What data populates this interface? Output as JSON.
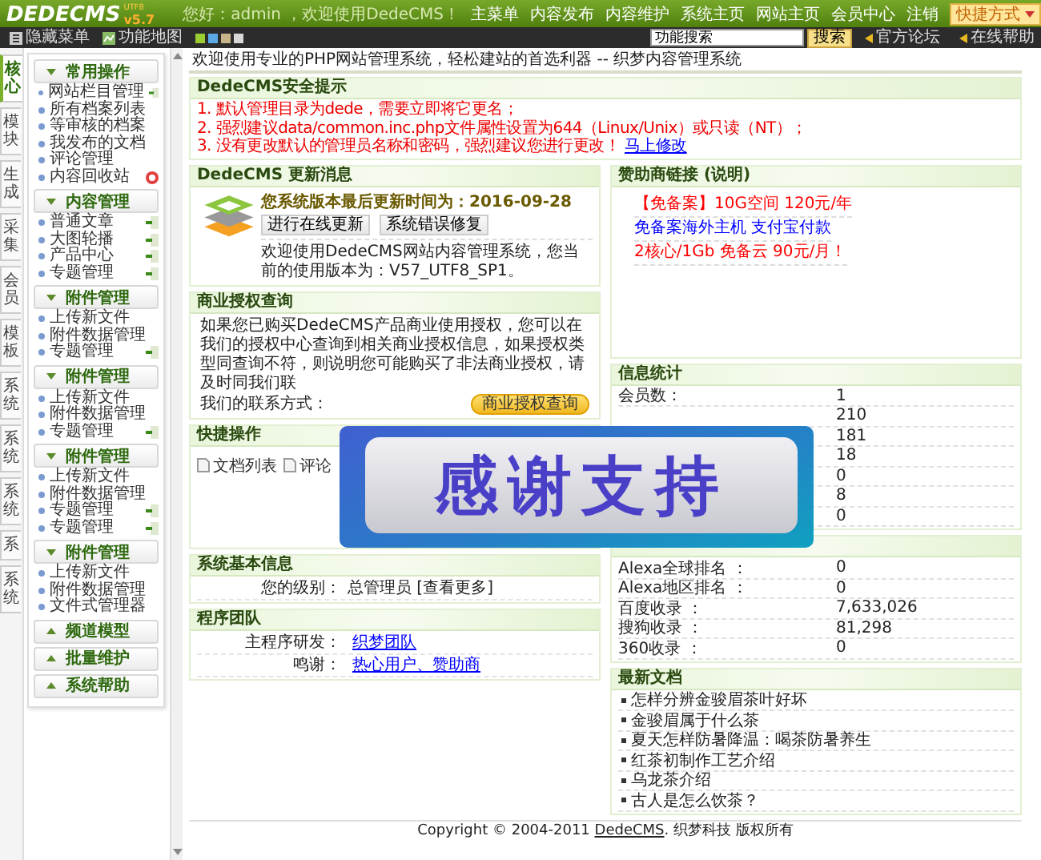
{
  "header": {
    "logo": "DEDECMS",
    "version": "v5.7",
    "edition": "UTF8",
    "greeting": "您好：admin ，欢迎使用DedeCMS！",
    "nav": [
      "主菜单",
      "内容发布",
      "内容维护",
      "系统主页",
      "网站主页",
      "会员中心",
      "注销"
    ],
    "shortcut": "快捷方式"
  },
  "toolbar": {
    "hide_menu": "隐藏菜单",
    "site_map": "功能地图",
    "themes": [
      {
        "color": "#9acd32"
      },
      {
        "color": "#5aa9e6"
      },
      {
        "color": "#c8b48a"
      },
      {
        "color": "#d8d8d8"
      }
    ],
    "search": {
      "value": "功能搜索"
    },
    "search_button": "搜索",
    "links": [
      "官方论坛",
      "在线帮助"
    ]
  },
  "side_tabs": [
    {
      "label": "核心",
      "selected": true
    },
    {
      "label": "模块",
      "selected": false
    },
    {
      "label": "生成",
      "selected": false
    },
    {
      "label": "采集",
      "selected": false
    },
    {
      "label": "会员",
      "selected": false
    },
    {
      "label": "模板",
      "selected": false
    },
    {
      "label": "系统",
      "selected": false
    },
    {
      "label": "系统",
      "selected": false
    },
    {
      "label": "系统",
      "selected": false
    },
    {
      "label": "系",
      "selected": false
    },
    {
      "label": "系统",
      "selected": false
    }
  ],
  "menu": [
    {
      "title": "常用操作",
      "expanded": true,
      "items": [
        {
          "label": "网站栏目管理",
          "kind": "add"
        },
        {
          "label": "所有档案列表",
          "kind": "plain"
        },
        {
          "label": "等审核的档案",
          "kind": "plain"
        },
        {
          "label": "我发布的文档",
          "kind": "plain"
        },
        {
          "label": "评论管理",
          "kind": "plain"
        },
        {
          "label": "内容回收站",
          "kind": "trash"
        }
      ]
    },
    {
      "title": "内容管理",
      "expanded": true,
      "items": [
        {
          "label": "普通文章",
          "kind": "add"
        },
        {
          "label": "大图轮播",
          "kind": "add"
        },
        {
          "label": "产品中心",
          "kind": "add"
        },
        {
          "label": "专题管理",
          "kind": "add"
        }
      ]
    },
    {
      "title": "附件管理",
      "expanded": true,
      "items": [
        {
          "label": "上传新文件",
          "kind": "plain"
        },
        {
          "label": "附件数据管理",
          "kind": "plain"
        },
        {
          "label": "专题管理",
          "kind": "add"
        }
      ]
    },
    {
      "title": "附件管理",
      "expanded": true,
      "items": [
        {
          "label": "上传新文件",
          "kind": "plain"
        },
        {
          "label": "附件数据管理",
          "kind": "plain"
        },
        {
          "label": "专题管理",
          "kind": "add"
        }
      ]
    },
    {
      "title": "附件管理",
      "expanded": true,
      "items": [
        {
          "label": "上传新文件",
          "kind": "plain"
        },
        {
          "label": "附件数据管理",
          "kind": "plain"
        },
        {
          "label": "专题管理",
          "kind": "add"
        },
        {
          "label": "专题管理",
          "kind": "add"
        }
      ]
    },
    {
      "title": "附件管理",
      "expanded": true,
      "items": [
        {
          "label": "上传新文件",
          "kind": "plain"
        },
        {
          "label": "附件数据管理",
          "kind": "plain"
        },
        {
          "label": "文件式管理器",
          "kind": "plain"
        }
      ]
    },
    {
      "title": "频道模型",
      "expanded": false
    },
    {
      "title": "批量维护",
      "expanded": false
    },
    {
      "title": "系统帮助",
      "expanded": false
    }
  ],
  "breadcrumb": "欢迎使用专业的PHP网站管理系统，轻松建站的首选利器 -- 织梦内容管理系统",
  "security": {
    "title": "DedeCMS安全提示",
    "tips": [
      "1. 默认管理目录为dede，需要立即将它更名；",
      "2. 强烈建议data/common.inc.php文件属性设置为644（Linux/Unix）或只读（NT）；",
      "3. 没有更改默认的管理员名称和密码，强烈建议您进行更改！"
    ],
    "link": "马上修改"
  },
  "update": {
    "title": "DedeCMS 更新消息",
    "date_line": "您系统版本最后更新时间为：2016-09-28",
    "buttons": [
      "进行在线更新",
      "系统错误修复"
    ],
    "version_line": "欢迎使用DedeCMS网站内容管理系统，您当前的使用版本为：V57_UTF8_SP1。"
  },
  "license": {
    "title": "商业授权查询",
    "text": "如果您已购买DedeCMS产品商业使用授权，您可以在我们的授权中心查询到相关商业授权信息，如果授权类型同查询不符，则说明您可能购买了非法商业授权，请及时同我们联",
    "contact": "我们的联系方式：",
    "button": "商业授权查询"
  },
  "quick": {
    "title": "快捷操作",
    "items": [
      "文档列表",
      "评论"
    ]
  },
  "sysinfo": {
    "title": "系统基本信息",
    "rows": [
      {
        "label": "您的级别：",
        "value": "总管理员 [查看更多]"
      }
    ]
  },
  "team": {
    "title": "程序团队",
    "rows": [
      {
        "label": "主程序研发：",
        "link": "织梦团队"
      },
      {
        "label": "鸣谢：",
        "link": "热心用户、赞助商"
      }
    ]
  },
  "sponsors": {
    "title": "赞助商链接 **(说明)**",
    "links": [
      {
        "text": "【免备案】10G空间 120元/年",
        "color": "#ff0000"
      },
      {
        "text": "免备案海外主机 支付宝付款",
        "color": "#0000ff"
      },
      {
        "text": "2核心/1Gb 免备云 90元/月！",
        "color": "#ff0000"
      }
    ]
  },
  "stats": {
    "title": "信息统计",
    "rows": [
      {
        "label": "会员数：",
        "value": "1"
      },
      {
        "value": "210"
      },
      {
        "value": "181"
      },
      {
        "value": "18"
      },
      {
        "value": "0"
      },
      {
        "value": "8"
      },
      {
        "value": "0"
      }
    ]
  },
  "ranks": {
    "rows": [
      {
        "label": "Alexa全球排名 ：",
        "value": "0"
      },
      {
        "label": "Alexa地区排名 ：",
        "value": "0"
      },
      {
        "label": "百度收录 ：",
        "value": "7,633,026"
      },
      {
        "label": "搜狗收录 ：",
        "value": "81,298"
      },
      {
        "label": "360收录 ：",
        "value": "0"
      }
    ]
  },
  "latest": {
    "title": "最新文档",
    "items": [
      "怎样分辨金骏眉茶叶好坏",
      "金骏眉属于什么茶",
      "夏天怎样防暑降温：喝茶防暑养生",
      "红茶初制作工艺介绍",
      "乌龙茶介绍",
      "古人是怎么饮茶？"
    ]
  },
  "footer": {
    "prefix": "Copyright © 2004-2011",
    "brand": "DedeCMS",
    "suffix": ". 织梦科技 版权所有"
  },
  "overlay": {
    "text": "感谢支持"
  }
}
